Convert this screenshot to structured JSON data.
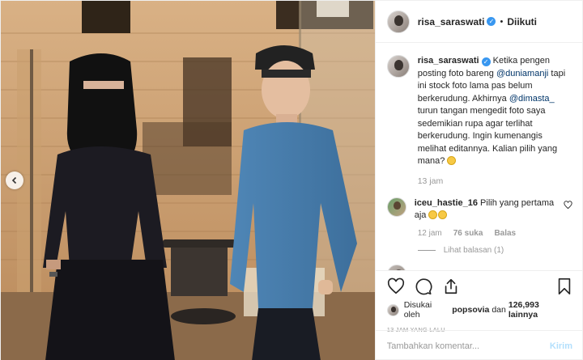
{
  "header": {
    "username": "risa_saraswati",
    "separator": "•",
    "follow_status": "Diikuti"
  },
  "caption": {
    "username": "risa_saraswati",
    "text_1": "Ketika pengen posting foto bareng ",
    "mention_1": "@duniamanji",
    "text_2": " tapi ini stock foto lama pas belum berkerudung. Akhirnya ",
    "mention_2": "@dimasta_",
    "text_3": " turun tangan mengedit foto saya sedemikian rupa agar terlihat berkerudung. Ingin kumenangis melihat editannya. Kalian pilih yang mana? ",
    "time": "13 jam"
  },
  "reply": {
    "username": "iceu_hastie_16",
    "text": " Pilih yang pertama aja ",
    "time": "12 jam",
    "likes": "76 suka",
    "reply_label": "Balas",
    "view_replies": "Lihat balasan (1)"
  },
  "likes": {
    "prefix": "Disukai oleh",
    "liker": "popsovia",
    "joiner": "dan",
    "count": "126,993 lainnya"
  },
  "timestamp": "13 JAM YANG LALU",
  "composer": {
    "placeholder": "Tambahkan komentar...",
    "post_label": "Kirim"
  },
  "icons": [
    "heart-icon",
    "comment-icon",
    "share-icon",
    "bookmark-icon",
    "chevron-left-icon",
    "verified-icon"
  ],
  "colors": {
    "verified": "#3897f0",
    "link": "#003569",
    "muted": "#999999",
    "post_button": "#b2dffc"
  }
}
